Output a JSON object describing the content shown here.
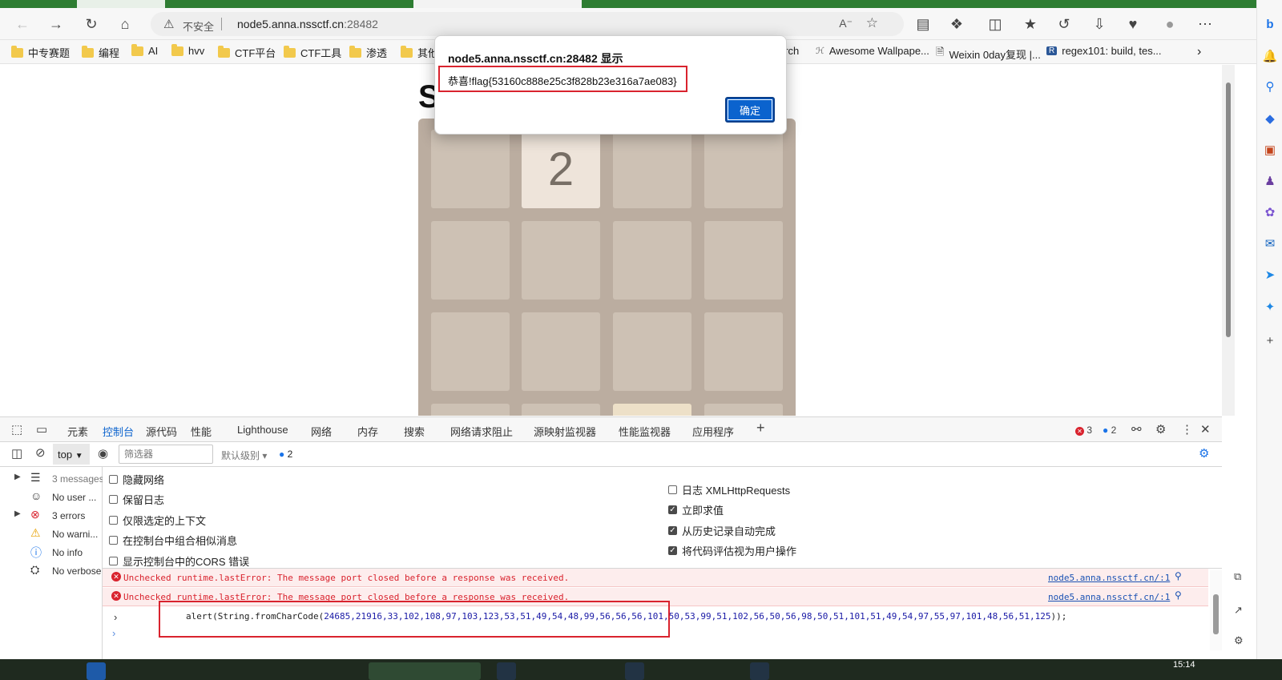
{
  "browser": {
    "address": {
      "insecure_label": "不安全",
      "host": "node5.anna.nssctf.cn",
      "port": ":28482"
    },
    "bookmarks": [
      {
        "label": "中专赛题",
        "icon": "folder-icon"
      },
      {
        "label": "编程",
        "icon": "folder-icon"
      },
      {
        "label": "AI",
        "icon": "folder-icon"
      },
      {
        "label": "hvv",
        "icon": "folder-icon"
      },
      {
        "label": "CTF平台",
        "icon": "folder-icon"
      },
      {
        "label": "CTF工具",
        "icon": "folder-icon"
      },
      {
        "label": "渗透",
        "icon": "folder-icon"
      },
      {
        "label": "其他",
        "icon": "folder-icon"
      },
      {
        "label": "arch",
        "icon": "link-icon"
      },
      {
        "label": "Awesome Wallpape...",
        "icon": "wallpaper-icon"
      },
      {
        "label": "Weixin 0day复现 |...",
        "icon": "document-icon"
      },
      {
        "label": "regex101: build, tes...",
        "icon": "regex-icon"
      }
    ]
  },
  "page": {
    "title_partial": "S",
    "tile_value": "2"
  },
  "dialog": {
    "title": "node5.anna.nssctf.cn:28482 显示",
    "message": "恭喜!flag{53160c888e25c3f828b23e316a7ae083}",
    "ok_label": "确定"
  },
  "devtools": {
    "tabs": [
      "元素",
      "控制台",
      "源代码",
      "性能",
      "Lighthouse",
      "网络",
      "内存",
      "搜索",
      "网络请求阻止",
      "源映射监视器",
      "性能监视器",
      "应用程序"
    ],
    "active_tab": "控制台",
    "error_count": "3",
    "info_count": "2",
    "toolbar": {
      "context": "top",
      "filter_placeholder": "筛选器",
      "level": "默认级别",
      "issues": "2"
    },
    "side_items": [
      {
        "label": "3 messages",
        "icon": "list-icon",
        "expandable": true
      },
      {
        "label": "No user ...",
        "icon": "user-icon",
        "expandable": false
      },
      {
        "label": "3 errors",
        "icon": "error-icon",
        "expandable": true
      },
      {
        "label": "No warni...",
        "icon": "warning-icon",
        "expandable": false
      },
      {
        "label": "No info",
        "icon": "info-icon",
        "expandable": false
      },
      {
        "label": "No verbose",
        "icon": "bug-icon",
        "expandable": false
      }
    ],
    "settings_left": [
      {
        "label": "隐藏网络",
        "checked": false
      },
      {
        "label": "保留日志",
        "checked": false
      },
      {
        "label": "仅限选定的上下文",
        "checked": false
      },
      {
        "label": "在控制台中组合相似消息",
        "checked": false
      },
      {
        "label": "显示控制台中的CORS 错误",
        "checked": false
      }
    ],
    "settings_right": [
      {
        "label": "日志 XMLHttpRequests",
        "checked": false
      },
      {
        "label": "立即求值",
        "checked": true
      },
      {
        "label": "从历史记录自动完成",
        "checked": true
      },
      {
        "label": "将代码评估视为用户操作",
        "checked": true
      }
    ],
    "errors": [
      {
        "text": "Unchecked runtime.lastError: The message port closed before a response was received.",
        "source": "node5.anna.nssctf.cn/:1"
      },
      {
        "text": "Unchecked runtime.lastError: The message port closed before a response was received.",
        "source": "node5.anna.nssctf.cn/:1"
      }
    ],
    "input": {
      "prefix": "alert(String.fromCharCode(",
      "args": "24685,21916,33,102,108,97,103,123,53,51,49,54,48,99,56,56,56,101,50,53,99,51,102,56,50,56,98,50,51,101,51,49,54,97,55,97,101,48,56,51,125",
      "suffix": "));"
    }
  },
  "taskbar": {
    "time": "15:14"
  },
  "colors": {
    "accent": "#0b63ce",
    "error": "#d9232e",
    "board": "#bbada0",
    "tile_empty": "#cdc1b4",
    "tile_2": "#eee4da"
  }
}
